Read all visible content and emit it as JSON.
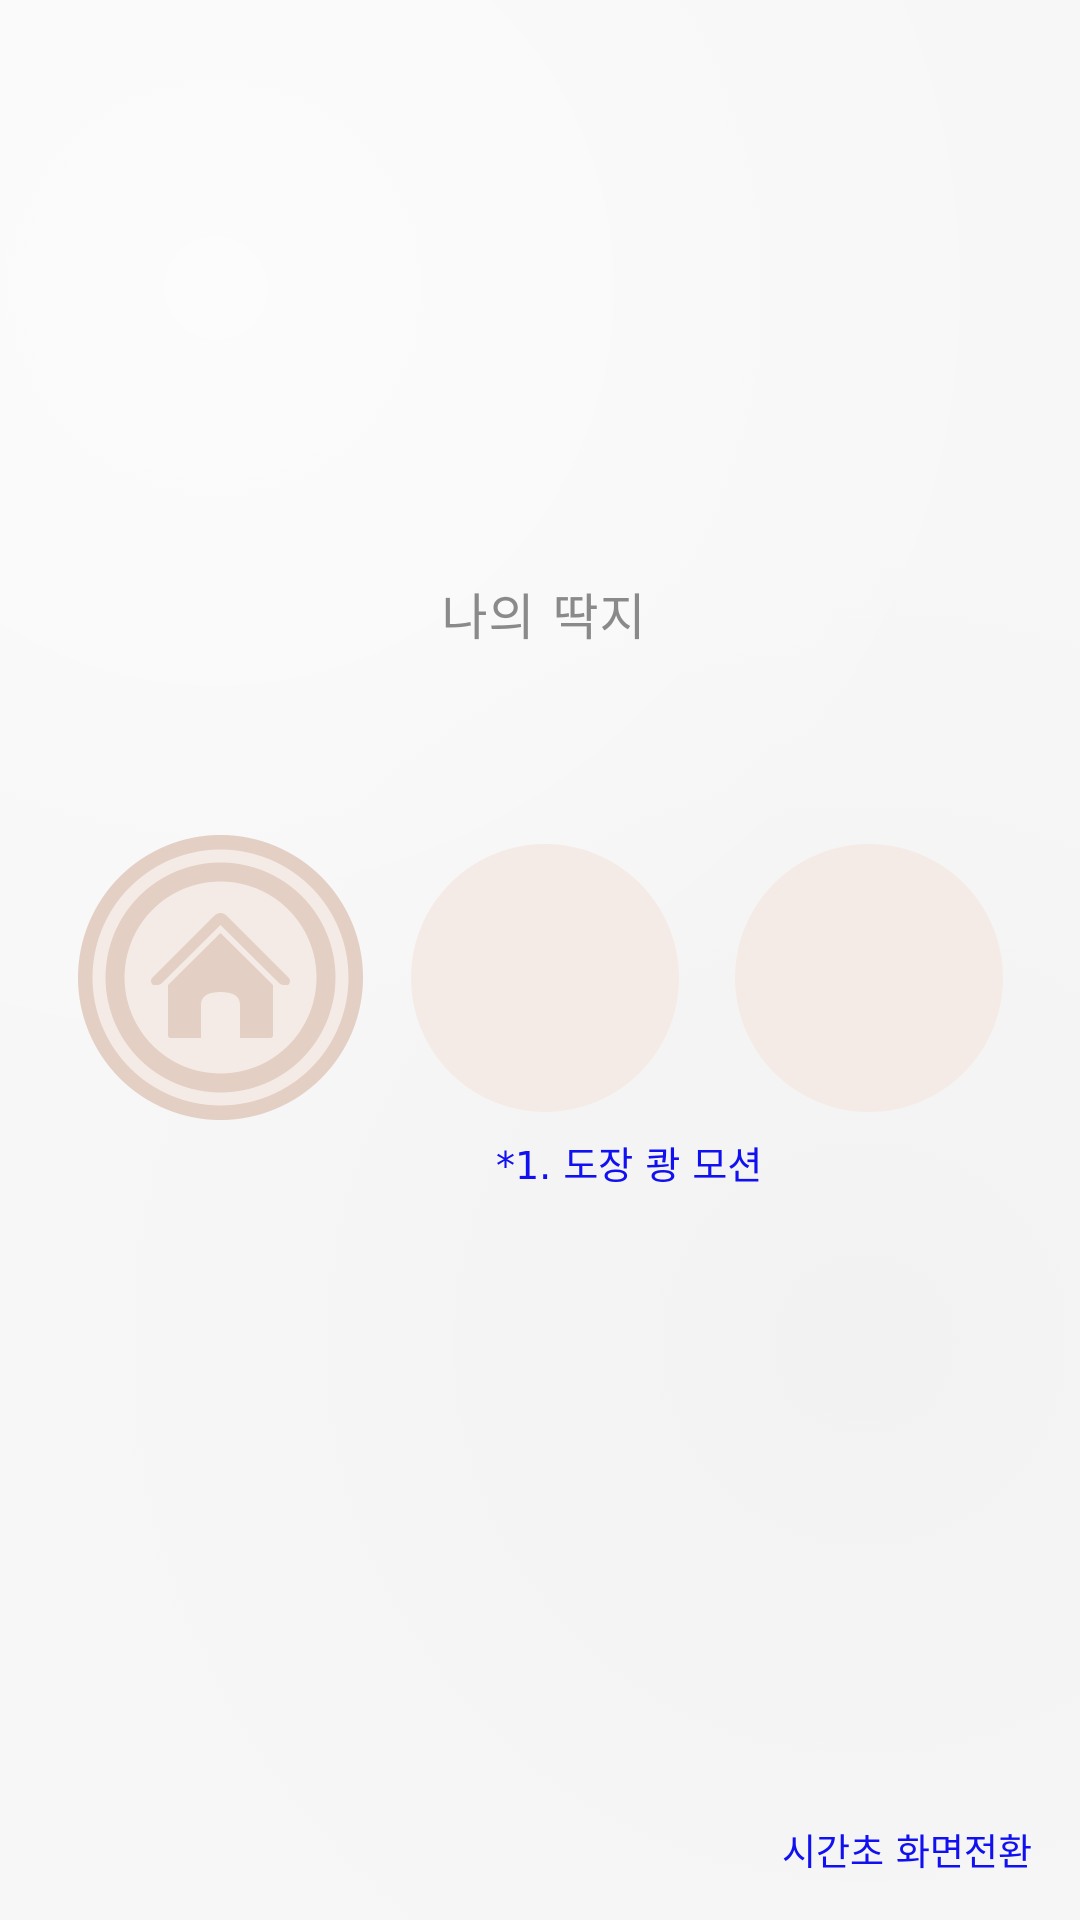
{
  "screen": {
    "title": "나의 딱지",
    "stamp_note": "*1. 도장 쾅 모션",
    "transition_link": "시간초 화면전환"
  },
  "stamps": [
    {
      "state": "stamped",
      "icon": "home-icon"
    },
    {
      "state": "empty"
    },
    {
      "state": "empty"
    }
  ],
  "colors": {
    "background": "#f7f7f7",
    "title": "#8a8a8a",
    "stamp_fill": "#f5ebe6",
    "stamp_ring": "#e3cfc3",
    "annotation": "#1010f0"
  }
}
